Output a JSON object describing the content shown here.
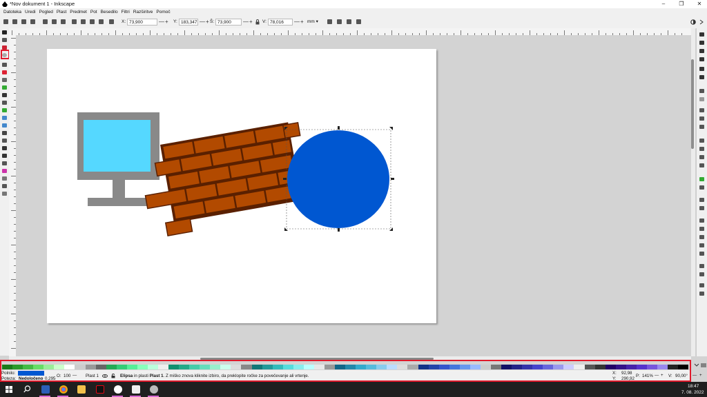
{
  "window": {
    "title": "*Nov dokument 1 - Inkscape",
    "min": "–",
    "restore": "❐",
    "close": "✕"
  },
  "menu": [
    "Datoteka",
    "Uredi",
    "Pogled",
    "Plast",
    "Predmet",
    "Pot",
    "Besedilo",
    "Filtri",
    "Razširitve",
    "Pomoč"
  ],
  "toolbar": {
    "x_label": "X:",
    "x_value": "73,900",
    "y_label": "Y:",
    "y_value": "183,347",
    "w_label": "Š:",
    "w_value": "73,900",
    "h_label": "V:",
    "h_value": "78,016",
    "unit": "mm ▾",
    "minus": "—",
    "plus": "+"
  },
  "status": {
    "fill_label": "Polnilo:",
    "stroke_label": "Poteza:",
    "stroke_value": "Nedoločeno",
    "stroke_width": "0,295",
    "opacity_label": "O:",
    "opacity_value": "100",
    "layer": "Plast 1",
    "message_bold": "Elipsa",
    "message_mid": " in plasti ",
    "message_layer": "Plast 1",
    "message_rest": ". Z miško znova kliknite izbiro, da preklopite ročke za povečevanje ali vrtenje.",
    "x_label": "X:",
    "x_value": "92,98",
    "y_label": "Y:",
    "y_value": "290,92",
    "zoom_label": "P:",
    "zoom_value": "141%",
    "rot_label": "V:",
    "rot_value": "90,00°"
  },
  "taskbar": {
    "time": "18:47",
    "date": "7. 08. 2022"
  },
  "colors": {
    "accent_highlight": "#e0192b",
    "monitor_frame": "#898989",
    "monitor_screen": "#55d8ff",
    "brick": "#b24a00",
    "mortar": "#5a2000",
    "circle": "#0057d1",
    "fill_swatch": "#0057d1"
  },
  "icons": [
    "inkscape-logo-icon",
    "selector-icon",
    "ellipse-tool-icon",
    "windows-start-icon",
    "search-icon",
    "word-icon",
    "chrome-icon",
    "file-explorer-icon",
    "netflix-icon",
    "inkscape-task-icon"
  ]
}
